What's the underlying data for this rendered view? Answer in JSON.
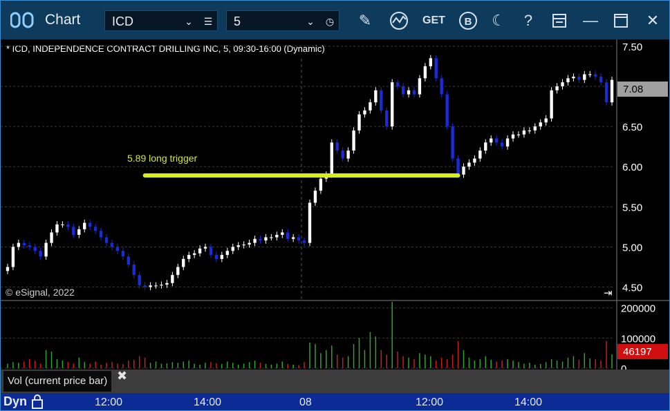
{
  "window": {
    "title": "Chart",
    "symbol": "ICD",
    "interval": "5",
    "toolbar_icons": [
      "pencil-icon",
      "study-icon",
      "get-icon",
      "b-icon",
      "moon-icon",
      "help-icon",
      "page-icon",
      "minimize-icon",
      "maximize-icon",
      "close-icon"
    ]
  },
  "chart_header": "* ICD, INDEPENDENCE CONTRACT DRILLING INC, 5, 09:30-16:00 (Dynamic)",
  "watermark": "© eSignal, 2022",
  "annotation": "5.89 long trigger",
  "price_label": "7.08",
  "volume_label": "46197",
  "vol_panel_label": "Vol (current price bar)",
  "bottom": {
    "dyn_label": "Dyn",
    "time_labels": [
      "12:00",
      "14:00",
      "08",
      "12:00",
      "14:00"
    ]
  },
  "colors": {
    "up": "#ffffff",
    "down": "#1b2bd6",
    "trigger_line": "#d8ee1c",
    "annotation_text": "#d8ee1c",
    "price_label_bg": "#a0a0a0",
    "volume_label_bg": "#d01010",
    "vol_up": "#2fa52f",
    "vol_down": "#c81e1e",
    "titlebar": "#0e3a5c",
    "bottom_bar": "#0c2b94"
  },
  "chart_data": {
    "type": "candlestick",
    "title": "* ICD, INDEPENDENCE CONTRACT DRILLING INC, 5, 09:30-16:00 (Dynamic)",
    "price_axis": {
      "ticks": [
        4.5,
        5.0,
        5.5,
        6.0,
        6.5,
        7.0,
        7.5
      ],
      "range": [
        4.35,
        7.55
      ]
    },
    "volume_axis": {
      "ticks": [
        0,
        100000,
        200000
      ],
      "range": [
        0,
        220000
      ]
    },
    "time_labels": [
      "12:00",
      "14:00",
      "08",
      "12:00",
      "14:00"
    ],
    "session_break_after_bar": 54,
    "trigger": {
      "label": "5.89 long trigger",
      "price": 5.89,
      "from_bar": 25,
      "to_bar": 82
    },
    "last_price": 7.08,
    "last_volume": 46197,
    "closes": [
      4.75,
      5.0,
      5.05,
      5.02,
      5.0,
      4.95,
      4.88,
      5.05,
      5.18,
      5.28,
      5.28,
      5.25,
      5.15,
      5.22,
      5.3,
      5.25,
      5.2,
      5.12,
      5.05,
      5.0,
      4.95,
      4.88,
      4.78,
      4.65,
      4.52,
      4.5,
      4.52,
      4.52,
      4.53,
      4.55,
      4.65,
      4.75,
      4.85,
      4.9,
      4.92,
      4.98,
      5.0,
      4.9,
      4.85,
      4.9,
      4.95,
      5.0,
      5.02,
      5.03,
      5.05,
      5.1,
      5.08,
      5.12,
      5.12,
      5.15,
      5.18,
      5.1,
      5.12,
      5.08,
      5.05,
      5.55,
      5.7,
      5.85,
      5.9,
      6.3,
      6.2,
      6.1,
      6.2,
      6.45,
      6.65,
      6.7,
      6.8,
      6.95,
      6.7,
      6.5,
      7.05,
      7.0,
      6.9,
      6.95,
      6.9,
      7.1,
      7.25,
      7.35,
      7.1,
      6.9,
      6.5,
      6.1,
      5.9,
      6.0,
      6.05,
      6.1,
      6.2,
      6.3,
      6.35,
      6.3,
      6.25,
      6.35,
      6.4,
      6.4,
      6.45,
      6.45,
      6.5,
      6.55,
      6.6,
      6.95,
      7.0,
      7.05,
      7.1,
      7.12,
      7.08,
      7.15,
      7.15,
      7.12,
      7.05,
      6.8,
      7.08
    ],
    "volumes": [
      15000,
      20000,
      18000,
      22000,
      30000,
      25000,
      15000,
      60000,
      55000,
      30000,
      25000,
      20000,
      15000,
      35000,
      20000,
      15000,
      22000,
      12000,
      18000,
      20000,
      15000,
      14000,
      25000,
      28000,
      40000,
      35000,
      18000,
      22000,
      15000,
      16000,
      20000,
      18000,
      22000,
      25000,
      15000,
      12000,
      18000,
      20000,
      16000,
      14000,
      22000,
      18000,
      12000,
      15000,
      20000,
      25000,
      18000,
      14000,
      12000,
      15000,
      22000,
      14000,
      12000,
      10000,
      20000,
      85000,
      80000,
      50000,
      60000,
      75000,
      45000,
      35000,
      40000,
      80000,
      100000,
      60000,
      120000,
      105000,
      60000,
      45000,
      220000,
      55000,
      40000,
      35000,
      30000,
      50000,
      45000,
      40000,
      25000,
      35000,
      30000,
      45000,
      90000,
      60000,
      35000,
      25000,
      30000,
      40000,
      28000,
      22000,
      25000,
      30000,
      25000,
      20000,
      15000,
      18000,
      12000,
      14000,
      20000,
      30000,
      25000,
      22000,
      35000,
      40000,
      28000,
      50000,
      32000,
      30000,
      25000,
      90000,
      46197
    ]
  }
}
